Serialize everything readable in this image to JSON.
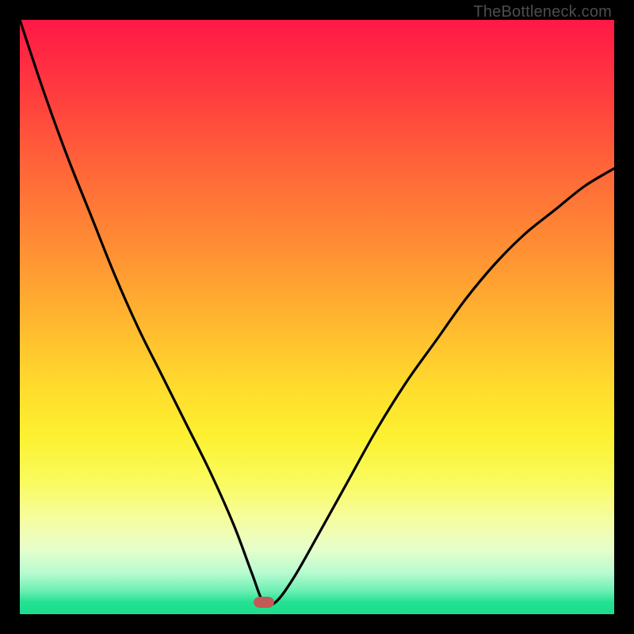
{
  "attribution": "TheBottleneck.com",
  "chart_data": {
    "type": "line",
    "title": "",
    "xlabel": "",
    "ylabel": "",
    "xlim": [
      0,
      100
    ],
    "ylim": [
      0,
      100
    ],
    "grid": false,
    "legend": false,
    "background": "rainbow-vertical-gradient",
    "marker": {
      "x": 41,
      "y": 2,
      "color": "#c15a57",
      "shape": "rounded-rect"
    },
    "series": [
      {
        "name": "bottleneck-curve",
        "color": "#000000",
        "x": [
          0,
          4,
          8,
          12,
          16,
          20,
          24,
          28,
          32,
          36,
          39,
          41,
          43,
          46,
          50,
          55,
          60,
          65,
          70,
          75,
          80,
          85,
          90,
          95,
          100
        ],
        "y": [
          100,
          88,
          77,
          67,
          57,
          48,
          40,
          32,
          24,
          15,
          7,
          2,
          2,
          6,
          13,
          22,
          31,
          39,
          46,
          53,
          59,
          64,
          68,
          72,
          75
        ]
      }
    ]
  },
  "colors": {
    "frame": "#000000",
    "curve": "#000000",
    "marker": "#c15a57",
    "attribution_text": "#4d4d4d"
  }
}
